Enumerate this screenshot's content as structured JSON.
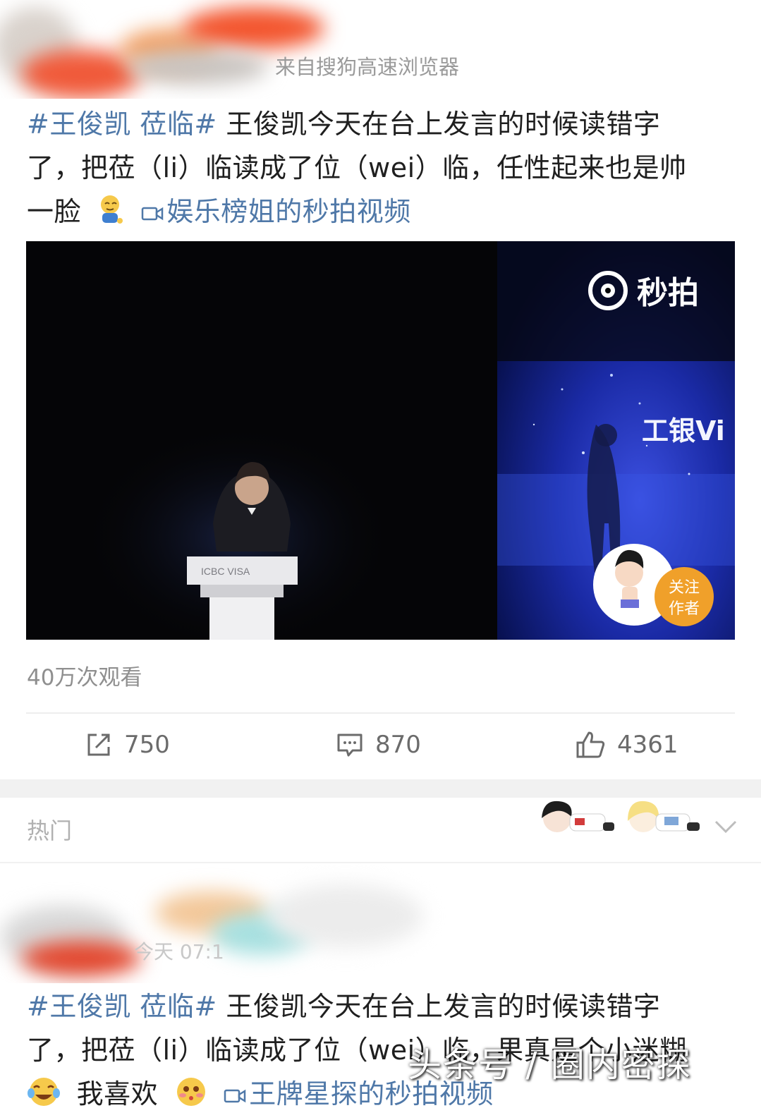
{
  "post1": {
    "source": "来自搜狗高速浏览器",
    "tag": "#王俊凯 莅临#",
    "text_line1": " 王俊凯今天在台上发言的时候读错字",
    "text_line2": "了，把莅（li）临读成了位（wei）临，任性起来也是帅",
    "text_line3": "一脸",
    "emoji_name": "smirk-emoji",
    "video_link": "娱乐榜姐的秒拍视频",
    "video": {
      "brand": "秒拍",
      "podium_logo": "ICBC  VISA",
      "screen_text": "工银Vi",
      "follow_label": "关注\n作者"
    },
    "views": "40万次观看",
    "actions": {
      "repost_count": "750",
      "comment_count": "870",
      "like_count": "4361"
    }
  },
  "hot_section": {
    "label": "热门"
  },
  "post2": {
    "time": "今天 07:1",
    "tag": "#王俊凯 莅临#",
    "text_line1": " 王俊凯今天在台上发言的时候读错字",
    "text_line2": "了，把莅（li）临读成了位（wei）临，果真是个小迷糊",
    "text_line3": "我喜欢",
    "video_link": "王牌星探的秒拍视频"
  },
  "watermark": "头条号 / 圈内密探",
  "colors": {
    "link": "#4f78a8",
    "muted": "#8f8f8f",
    "follow_badge": "#f0a02a"
  }
}
